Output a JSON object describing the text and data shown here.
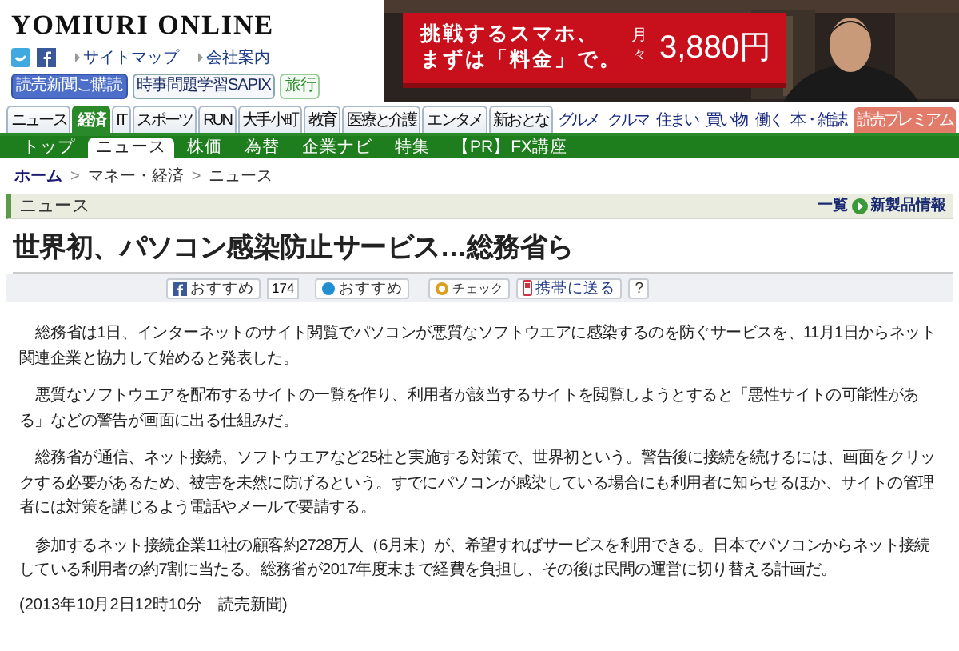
{
  "logo": "YOMIURI ONLINE",
  "utility_links": [
    "サイトマップ",
    "会社案内"
  ],
  "service_links": [
    {
      "label": "読売新聞ご購読",
      "kind": "filled"
    },
    {
      "label": "時事問題学習SAPIX",
      "kind": "outlined"
    },
    {
      "label": "旅行",
      "kind": "green"
    }
  ],
  "ad": {
    "line_1": "挑戦するスマホ、",
    "line_2": "まずは「料金」で。",
    "price_prefix": "月々",
    "price": "3,880円"
  },
  "category_tabs": [
    {
      "label": "ニュース",
      "kind": "tab",
      "selected": false
    },
    {
      "label": "経済",
      "kind": "tab",
      "selected": true
    },
    {
      "label": "IT",
      "kind": "tab",
      "selected": false
    },
    {
      "label": "スポーツ",
      "kind": "tab",
      "selected": false
    },
    {
      "label": "RUN",
      "kind": "tab",
      "selected": false
    },
    {
      "label": "大手小町",
      "kind": "tab",
      "selected": false
    },
    {
      "label": "教育",
      "kind": "tab",
      "selected": false
    },
    {
      "label": "医療と介護",
      "kind": "tab",
      "selected": false
    },
    {
      "label": "エンタメ",
      "kind": "tab",
      "selected": false
    },
    {
      "label": "新おとな",
      "kind": "tab",
      "selected": false
    },
    {
      "label": "グルメ",
      "kind": "link",
      "selected": false
    },
    {
      "label": "クルマ",
      "kind": "link",
      "selected": false
    },
    {
      "label": "住まい",
      "kind": "link",
      "selected": false
    },
    {
      "label": "買い物",
      "kind": "link",
      "selected": false
    },
    {
      "label": "働く",
      "kind": "link",
      "selected": false
    },
    {
      "label": "本・雑誌",
      "kind": "link",
      "selected": false
    },
    {
      "label": "読売プレミアム",
      "kind": "premium",
      "selected": false
    }
  ],
  "sub_tabs": [
    {
      "label": "トップ",
      "selected": false
    },
    {
      "label": "ニュース",
      "selected": true
    },
    {
      "label": "株価",
      "selected": false
    },
    {
      "label": "為替",
      "selected": false
    },
    {
      "label": "企業ナビ",
      "selected": false
    },
    {
      "label": "特集",
      "selected": false
    },
    {
      "label": "【PR】FX講座",
      "selected": false
    }
  ],
  "breadcrumb": {
    "items": [
      "ホーム",
      "マネー・経済",
      "ニュース"
    ],
    "separator": ">"
  },
  "section": {
    "title": "ニュース",
    "list_link": "一覧",
    "related_link": "新製品情報"
  },
  "headline": "世界初、パソコン感染防止サービス…総務省ら",
  "share": {
    "facebook_label": "おすすめ",
    "facebook_count": "174",
    "mixi_label": "おすすめ",
    "check_label": "チェック",
    "mobile_label": "携帯に送る",
    "help_label": "?"
  },
  "paragraphs": [
    "総務省は1日、インターネットのサイト閲覧でパソコンが悪質なソフトウエアに感染するのを防ぐサービスを、11月1日からネット関連企業と協力して始めると発表した。",
    "悪質なソフトウエアを配布するサイトの一覧を作り、利用者が該当するサイトを閲覧しようとすると「悪性サイトの可能性がある」などの警告が画面に出る仕組みだ。",
    "総務省が通信、ネット接続、ソフトウエアなど25社と実施する対策で、世界初という。警告後に接続を続けるには、画面をクリックする必要があるため、被害を未然に防げるという。すでにパソコンが感染している場合にも利用者に知らせるほか、サイトの管理者には対策を講じるよう電話やメールで要請する。",
    "参加するネット接続企業11社の顧客約2728万人（6月末）が、希望すればサービスを利用できる。日本でパソコンからネット接続している利用者の約7割に当たる。総務省が2017年度末まで経費を負担し、その後は民間の運営に切り替える計画だ。"
  ],
  "dateline": "(2013年10月2日12時10分　読売新聞)"
}
